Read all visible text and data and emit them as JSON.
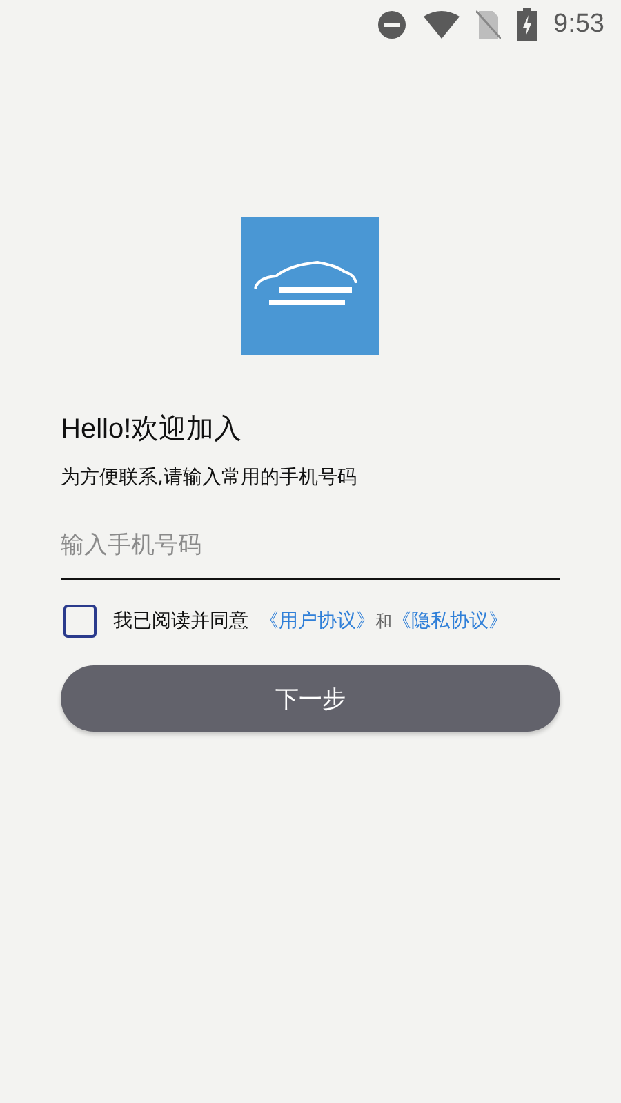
{
  "status_bar": {
    "time": "9:53"
  },
  "greeting": {
    "title": "Hello!欢迎加入",
    "subtitle": "为方便联系,请输入常用的手机号码"
  },
  "phone_field": {
    "placeholder": "输入手机号码"
  },
  "agreement": {
    "checked": false,
    "text": "我已阅读并同意",
    "links": [
      "《用户协议》",
      "《隐私协议》"
    ],
    "joiner": "和"
  },
  "next_button": {
    "label": "下一步",
    "disabled": true
  }
}
